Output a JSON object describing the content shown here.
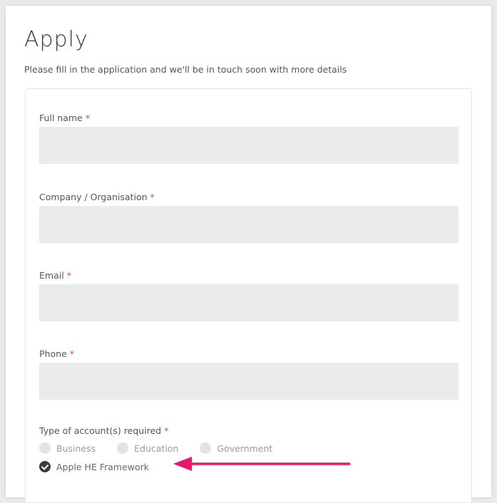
{
  "form": {
    "title": "Apply",
    "subtitle": "Please fill in the application and we'll be in touch soon with more details",
    "required_marker": "*",
    "fields": [
      {
        "label": "Full name",
        "value": ""
      },
      {
        "label": "Company / Organisation",
        "value": ""
      },
      {
        "label": "Email",
        "value": ""
      },
      {
        "label": "Phone",
        "value": ""
      }
    ],
    "account_type": {
      "label": "Type of account(s) required",
      "options": [
        {
          "label": "Business",
          "checked": false
        },
        {
          "label": "Education",
          "checked": false
        },
        {
          "label": "Government",
          "checked": false
        },
        {
          "label": "Apple HE Framework",
          "checked": true
        }
      ]
    }
  },
  "annotation": {
    "arrow_color": "#e8196a"
  },
  "colors": {
    "required": "#e0433d",
    "input_bg": "#ebebeb"
  }
}
